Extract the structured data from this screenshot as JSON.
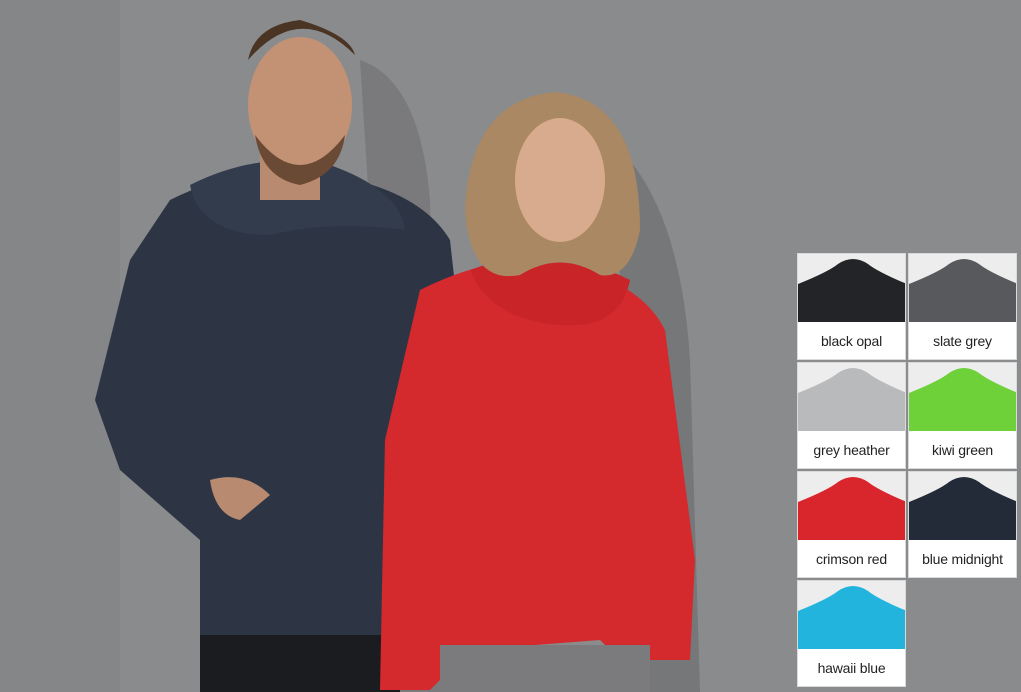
{
  "photo": {
    "subjects": [
      "man-in-navy-hoodie",
      "woman-in-red-hoodie"
    ]
  },
  "swatches": [
    {
      "label": "black opal",
      "color": "#222427"
    },
    {
      "label": "slate grey",
      "color": "#58595c"
    },
    {
      "label": "grey heather",
      "color": "#b9babc"
    },
    {
      "label": "kiwi green",
      "color": "#6ed13a"
    },
    {
      "label": "crimson red",
      "color": "#d9252c"
    },
    {
      "label": "blue midnight",
      "color": "#242b38"
    },
    {
      "label": "hawaii blue",
      "color": "#22b4dc"
    }
  ]
}
